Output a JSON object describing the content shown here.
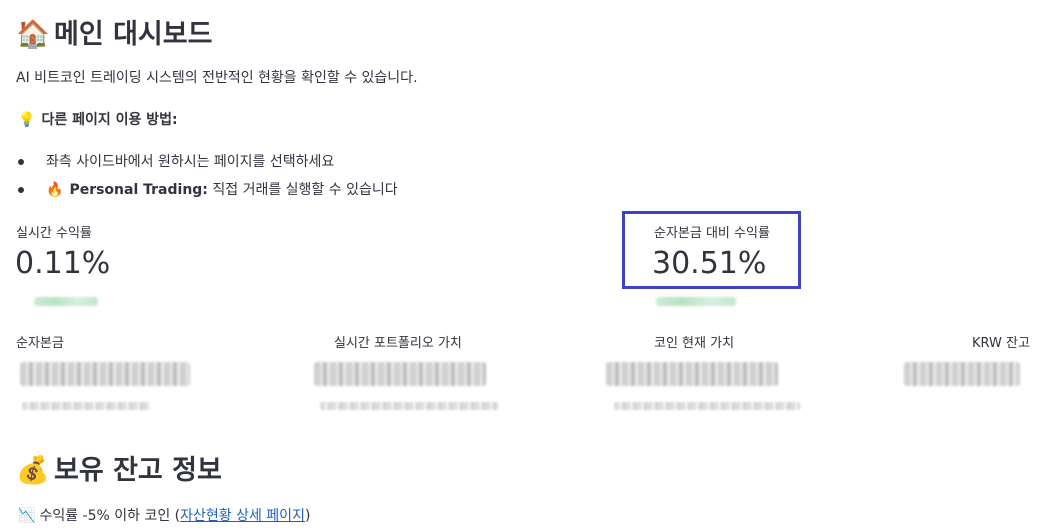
{
  "header": {
    "icon": "house-icon",
    "title": "메인 대시보드"
  },
  "intro": "AI 비트코인 트레이딩 시스템의 전반적인 현황을 확인할 수 있습니다.",
  "tips": {
    "icon": "lightbulb-icon",
    "heading": "다른 페이지 이용 방법:",
    "items": [
      {
        "text": "좌측 사이드바에서 원하시는 페이지를 선택하세요"
      },
      {
        "icon": "fire-icon",
        "bold": "Personal Trading:",
        "text": " 직접 거래를 실행할 수 있습니다"
      }
    ]
  },
  "metrics_top": [
    {
      "label": "실시간 수익률",
      "value": "0.11%"
    },
    {
      "label": "순자본금 대비 수익률",
      "value": "30.51%"
    }
  ],
  "metrics_bottom": [
    {
      "label": "순자본금"
    },
    {
      "label": "실시간 포트폴리오 가치"
    },
    {
      "label": "코인 현재 가치"
    },
    {
      "label": "KRW 잔고"
    }
  ],
  "holdings": {
    "icon": "money-bag-icon",
    "title": "보유 잔고 정보",
    "filter_icon": "chart-down-icon",
    "filter_text": "수익률 -5% 이하 코인 (",
    "link_text": "자산현황 상세 페이지",
    "filter_suffix": ")"
  },
  "colors": {
    "highlight": "#3c44c2",
    "text": "#31333f",
    "link": "#1f5fbf"
  }
}
